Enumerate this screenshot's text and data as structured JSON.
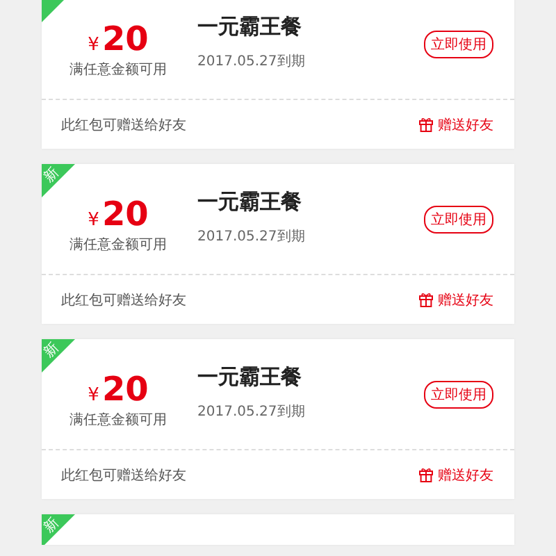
{
  "coupons": [
    {
      "tagged": true,
      "currency": "¥",
      "amount": "20",
      "condition": "满任意金额可用",
      "title": "一元霸王餐",
      "expiry": "2017.05.27到期",
      "action": "立即使用",
      "note": "此红包可赠送给好友",
      "share": "赠送好友"
    },
    {
      "tagged": true,
      "badge": "新",
      "currency": "¥",
      "amount": "20",
      "condition": "满任意金额可用",
      "title": "一元霸王餐",
      "expiry": "2017.05.27到期",
      "action": "立即使用",
      "note": "此红包可赠送给好友",
      "share": "赠送好友"
    },
    {
      "tagged": true,
      "badge": "新",
      "currency": "¥",
      "amount": "20",
      "condition": "满任意金额可用",
      "title": "一元霸王餐",
      "expiry": "2017.05.27到期",
      "action": "立即使用",
      "note": "此红包可赠送给好友",
      "share": "赠送好友"
    },
    {
      "tagged": true,
      "badge": "新"
    }
  ]
}
